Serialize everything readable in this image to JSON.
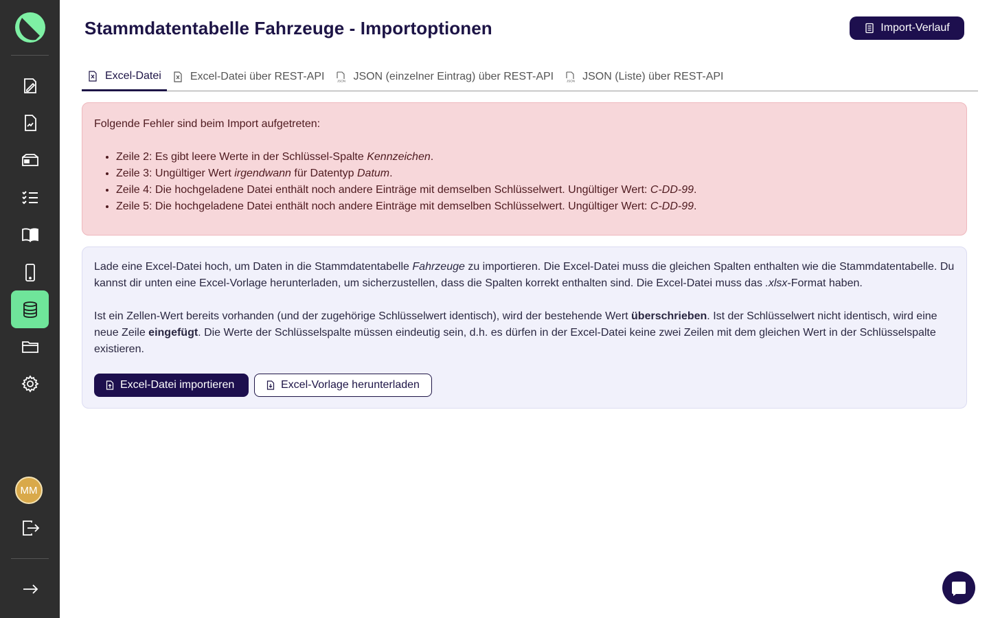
{
  "page": {
    "title": "Stammdatentabelle Fahrzeuge - Importoptionen",
    "history_button": "Import-Verlauf"
  },
  "sidebar": {
    "items": [
      {
        "icon": "edit-document-icon"
      },
      {
        "icon": "report-icon"
      },
      {
        "icon": "inbox-icon"
      },
      {
        "icon": "checklist-icon"
      },
      {
        "icon": "book-icon"
      },
      {
        "icon": "mobile-icon"
      },
      {
        "icon": "database-icon",
        "active": true
      },
      {
        "icon": "folder-icon"
      },
      {
        "icon": "settings-icon"
      }
    ],
    "avatar_initials": "MM"
  },
  "tabs": [
    {
      "label": "Excel-Datei",
      "icon": "excel-file-icon",
      "active": true
    },
    {
      "label": "Excel-Datei über REST-API",
      "icon": "excel-file-icon"
    },
    {
      "label": "JSON (einzelner Eintrag) über REST-API",
      "icon": "json-file-icon"
    },
    {
      "label": "JSON (Liste) über REST-API",
      "icon": "json-file-icon"
    }
  ],
  "alert": {
    "heading": "Folgende Fehler sind beim Import aufgetreten:",
    "errors": [
      {
        "prefix": "Zeile 2: Es gibt leere Werte in der Schlüssel-Spalte ",
        "em": "Kennzeichen",
        "suffix": ".",
        "em2": "",
        "suffix2": ""
      },
      {
        "prefix": "Zeile 3: Ungültiger Wert ",
        "em": "irgendwann",
        "suffix": " für Datentyp ",
        "em2": "Datum",
        "suffix2": "."
      },
      {
        "prefix": "Zeile 4: Die hochgeladene Datei enthält noch andere Einträge mit demselben Schlüsselwert. Ungültiger Wert: ",
        "em": "C-DD-99",
        "suffix": ".",
        "em2": "",
        "suffix2": ""
      },
      {
        "prefix": "Zeile 5: Die hochgeladene Datei enthält noch andere Einträge mit demselben Schlüsselwert. Ungültiger Wert: ",
        "em": "C-DD-99",
        "suffix": ".",
        "em2": "",
        "suffix2": ""
      }
    ]
  },
  "info": {
    "p1_a": "Lade eine Excel-Datei hoch, um Daten in die Stammdatentabelle ",
    "p1_em": "Fahrzeuge",
    "p1_b": " zu importieren. Die Excel-Datei muss die gleichen Spalten enthalten wie die Stammdatentabelle. Du kannst dir unten eine Excel-Vorlage herunterladen, um sicherzustellen, dass die Spalten korrekt enthalten sind. Die Excel-Datei muss das ",
    "p1_em2": ".xlsx",
    "p1_c": "-Format haben.",
    "p2_a": "Ist ein Zellen-Wert bereits vorhanden (und der zugehörige Schlüsselwert identisch), wird der bestehende Wert ",
    "p2_b1": "überschrieben",
    "p2_b": ". Ist der Schlüsselwert nicht identisch, wird eine neue Zeile ",
    "p2_b2": "eingefügt",
    "p2_c": ". Die Werte der Schlüsselspalte müssen eindeutig sein, d.h. es dürfen in der Excel-Datei keine zwei Zeilen mit dem gleichen Wert in der Schlüsselspalte existieren.",
    "import_button": "Excel-Datei importieren",
    "template_button": "Excel-Vorlage herunterladen"
  },
  "colors": {
    "sidebar": "#2e2e2e",
    "accent_green": "#6fe59a",
    "primary": "#1d0f4e",
    "alert_bg": "#f7d7da",
    "info_bg": "#f1f1fb"
  }
}
